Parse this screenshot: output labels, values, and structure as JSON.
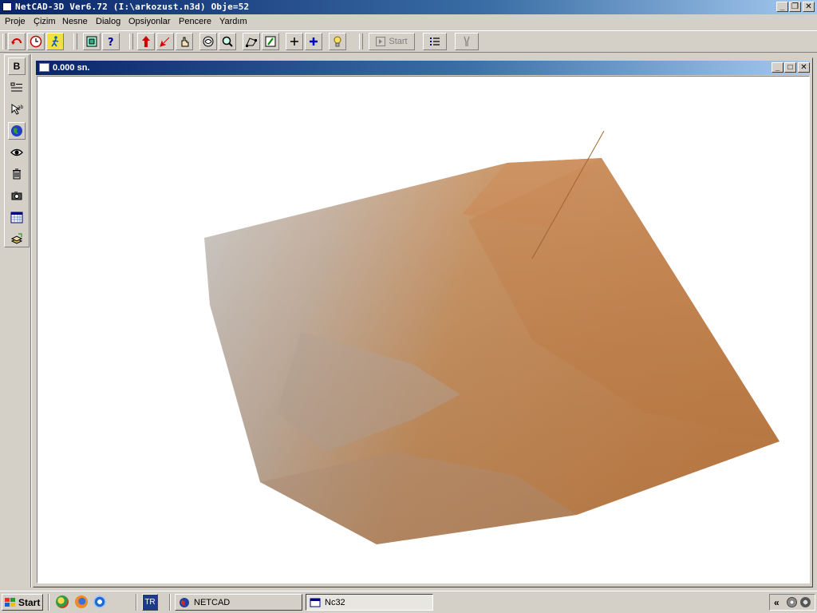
{
  "window": {
    "title": "NetCAD-3D Ver6.72  (I:\\arkozust.n3d)  Obje=52",
    "caption_buttons": [
      "minimize",
      "restore",
      "close"
    ]
  },
  "menu": [
    "Proje",
    "Çizim",
    "Nesne",
    "Dialog",
    "Opsiyonlar",
    "Pencere",
    "Yardım"
  ],
  "toolbar": {
    "groups": [
      [
        "rotate-icon",
        "clock-icon",
        "walk-icon"
      ],
      [
        "zoom-extents-icon",
        "help-icon"
      ],
      [
        "arrow-up-icon",
        "arrow-down-icon",
        "hand-icon",
        "view-icon",
        "zoom-in-icon",
        "window-select-icon",
        "pan-icon",
        "add-outline-icon",
        "add-icon",
        "lightbulb-icon"
      ]
    ],
    "start_label": "Start"
  },
  "left_tools": {
    "b_label": "B",
    "icons": [
      "layers-list-icon",
      "cursor-text-icon",
      "globe-icon",
      "eye-icon",
      "trash-icon",
      "camera-icon",
      "calendar-icon",
      "stack-icon"
    ]
  },
  "child_window": {
    "title": "0.000 sn."
  },
  "taskbar": {
    "start_label": "Start",
    "language": "TR",
    "tasks": [
      {
        "label": "NETCAD",
        "active": false
      },
      {
        "label": "Nc32",
        "active": true
      }
    ],
    "tray_chevron": "«"
  },
  "colors": {
    "title_start": "#0a246a",
    "title_end": "#a6caf0",
    "surface_tan": "#c5834a",
    "surface_gray": "#c8c4c0"
  }
}
